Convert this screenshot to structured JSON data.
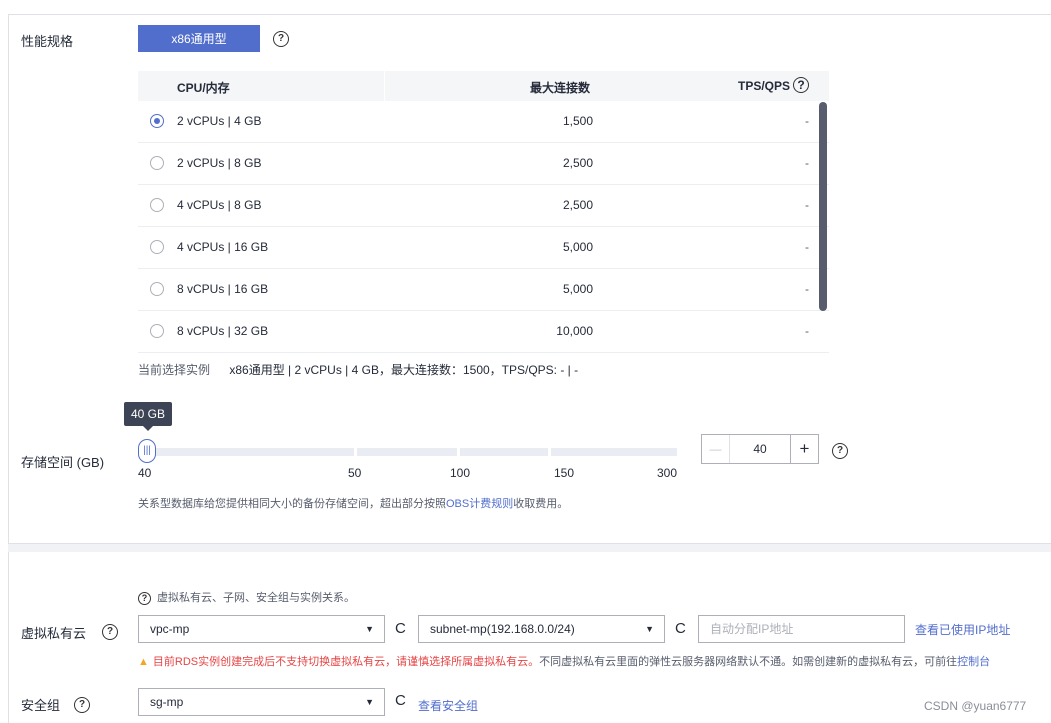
{
  "flavor": {
    "label": "性能规格",
    "selected_type": "x86通用型",
    "help": "?",
    "columns": [
      "CPU/内存",
      "最大连接数",
      "TPS/QPS"
    ],
    "rows": [
      {
        "cpu_mem": "2 vCPUs | 4 GB",
        "max_conn": "1,500",
        "tps": "-",
        "selected": true
      },
      {
        "cpu_mem": "2 vCPUs | 8 GB",
        "max_conn": "2,500",
        "tps": "-",
        "selected": false
      },
      {
        "cpu_mem": "4 vCPUs | 8 GB",
        "max_conn": "2,500",
        "tps": "-",
        "selected": false
      },
      {
        "cpu_mem": "4 vCPUs | 16 GB",
        "max_conn": "5,000",
        "tps": "-",
        "selected": false
      },
      {
        "cpu_mem": "8 vCPUs | 16 GB",
        "max_conn": "5,000",
        "tps": "-",
        "selected": false
      },
      {
        "cpu_mem": "8 vCPUs | 32 GB",
        "max_conn": "10,000",
        "tps": "-",
        "selected": false
      }
    ],
    "current_label": "当前选择实例",
    "current_value": "x86通用型 | 2 vCPUs | 4 GB，最大连接数：1500，TPS/QPS: - | -"
  },
  "storage": {
    "label": "存储空间 (GB)",
    "tooltip": "40 GB",
    "ticks": [
      "40",
      "50",
      "100",
      "150",
      "300"
    ],
    "value": "40",
    "minus": "—",
    "plus": "+",
    "note_prefix": "关系型数据库给您提供相同大小的备份存储空间，超出部分按照",
    "note_link": "OBS计费规则",
    "note_suffix": "收取费用。"
  },
  "vpc": {
    "hint": "虚拟私有云、子网、安全组与实例关系。",
    "label": "虚拟私有云",
    "vpc_value": "vpc-mp",
    "subnet_value": "subnet-mp(192.168.0.0/24)",
    "ip_placeholder": "自动分配IP地址",
    "ip_link": "查看已使用IP地址",
    "warn_red": "目前RDS实例创建完成后不支持切换虚拟私有云，请谨慎选择所属虚拟私有云。",
    "warn_gray": "不同虚拟私有云里面的弹性云服务器网络默认不通。如需创建新的虚拟私有云，可前往",
    "warn_link": "控制台"
  },
  "security_group": {
    "label": "安全组",
    "value": "sg-mp",
    "link": "查看安全组"
  },
  "watermark": "CSDN @yuan6777"
}
